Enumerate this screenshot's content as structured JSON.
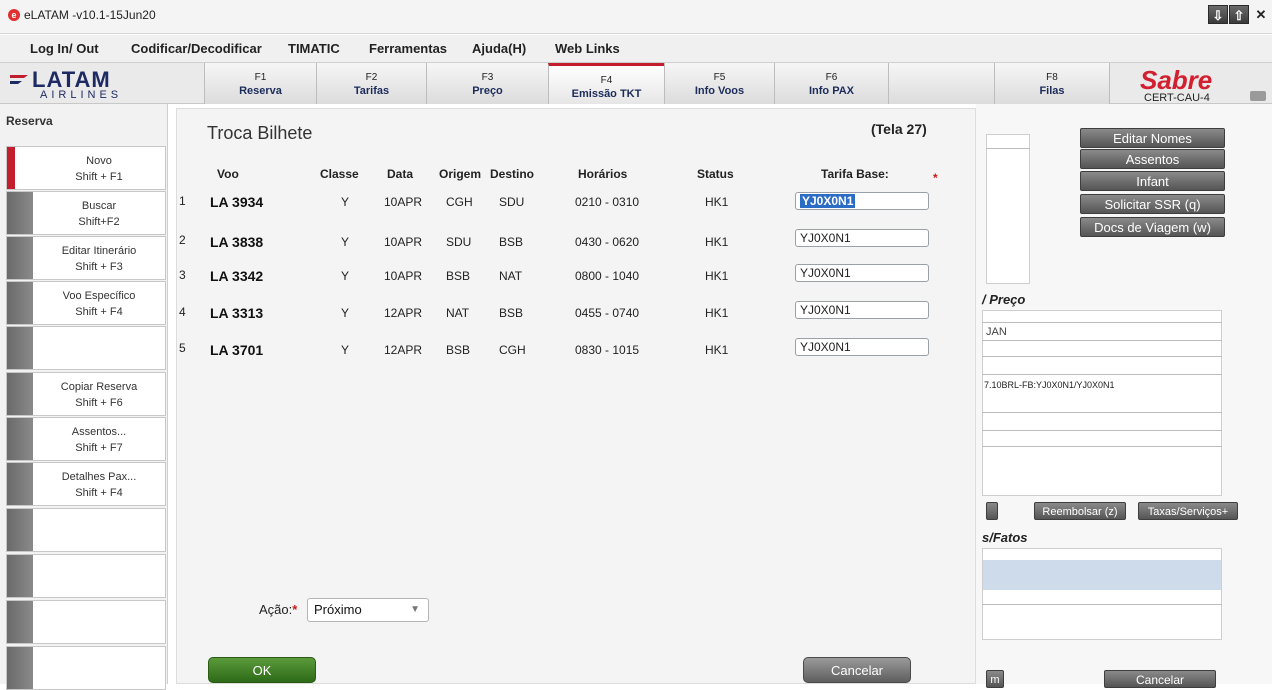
{
  "window": {
    "title": "eLATAM -v10.1-15Jun20",
    "logo_letter": "e",
    "buttons": [
      "⇩",
      "⇧",
      "✕"
    ]
  },
  "menu": {
    "items": [
      "Log In/ Out",
      "Codificar/Decodificar",
      "TIMATIC",
      "Ferramentas",
      "Ajuda(H)",
      "Web Links"
    ]
  },
  "brand": {
    "latam": "LATAM",
    "airlines": "AIRLINES",
    "sabre": "Sabre",
    "cert": "CERT-CAU-4"
  },
  "fkeys": [
    {
      "key": "F1",
      "label": "Reserva"
    },
    {
      "key": "F2",
      "label": "Tarifas"
    },
    {
      "key": "F3",
      "label": "Preço"
    },
    {
      "key": "F4",
      "label": "Emissão TKT"
    },
    {
      "key": "F5",
      "label": "Info Voos"
    },
    {
      "key": "F6",
      "label": "Info PAX"
    },
    {
      "key": "",
      "label": ""
    },
    {
      "key": "F8",
      "label": "Filas"
    }
  ],
  "sidebar": {
    "title": "Reserva",
    "items": [
      {
        "l1": "Novo",
        "l2": "Shift + F1"
      },
      {
        "l1": "Buscar",
        "l2": "Shift+F2"
      },
      {
        "l1": "Editar Itinerário",
        "l2": "Shift + F3"
      },
      {
        "l1": "Voo Específico",
        "l2": "Shift + F4"
      },
      {
        "l1": "",
        "l2": ""
      },
      {
        "l1": "Copiar Reserva",
        "l2": "Shift + F6"
      },
      {
        "l1": "Assentos...",
        "l2": "Shift + F7"
      },
      {
        "l1": "Detalhes Pax...",
        "l2": "Shift + F4"
      },
      {
        "l1": "",
        "l2": ""
      },
      {
        "l1": "",
        "l2": ""
      },
      {
        "l1": "",
        "l2": ""
      },
      {
        "l1": "",
        "l2": ""
      }
    ]
  },
  "dialog": {
    "title": "Troca Bilhete",
    "screen": "(Tela 27)",
    "columns": [
      "Voo",
      "Classe",
      "Data",
      "Origem",
      "Destino",
      "Horários",
      "Status",
      "Tarifa Base:"
    ],
    "required_mark": "*",
    "rows": [
      {
        "n": "1",
        "voo": "LA 3934",
        "classe": "Y",
        "data": "10APR",
        "origem": "CGH",
        "destino": "SDU",
        "horarios": "0210 - 0310",
        "status": "HK1",
        "tarifa": "YJ0X0N1"
      },
      {
        "n": "2",
        "voo": "LA 3838",
        "classe": "Y",
        "data": "10APR",
        "origem": "SDU",
        "destino": "BSB",
        "horarios": "0430 - 0620",
        "status": "HK1",
        "tarifa": "YJ0X0N1"
      },
      {
        "n": "3",
        "voo": "LA 3342",
        "classe": "Y",
        "data": "10APR",
        "origem": "BSB",
        "destino": "NAT",
        "horarios": "0800 - 1040",
        "status": "HK1",
        "tarifa": "YJ0X0N1"
      },
      {
        "n": "4",
        "voo": "LA 3313",
        "classe": "Y",
        "data": "12APR",
        "origem": "NAT",
        "destino": "BSB",
        "horarios": "0455 - 0740",
        "status": "HK1",
        "tarifa": "YJ0X0N1"
      },
      {
        "n": "5",
        "voo": "LA 3701",
        "classe": "Y",
        "data": "12APR",
        "origem": "BSB",
        "destino": "CGH",
        "horarios": "0830 - 1015",
        "status": "HK1",
        "tarifa": "YJ0X0N1"
      }
    ],
    "acao_label": "Ação:",
    "acao_value": "Próximo",
    "ok": "OK",
    "cancel": "Cancelar"
  },
  "right_panel": {
    "buttons": [
      "Editar Nomes",
      "Assentos",
      "Infant",
      "Solicitar SSR (q)",
      "Docs de Viagem (w)"
    ],
    "section_preco": "/ Preço",
    "jan": "JAN",
    "fare_text": "7.10BRL-FB:YJ0X0N1/YJ0X0N1",
    "reembolsar": "Reembolsar (z)",
    "taxas": "Taxas/Serviços+",
    "section_fatos": "s/Fatos",
    "cancel": "Cancelar",
    "m": "m"
  }
}
